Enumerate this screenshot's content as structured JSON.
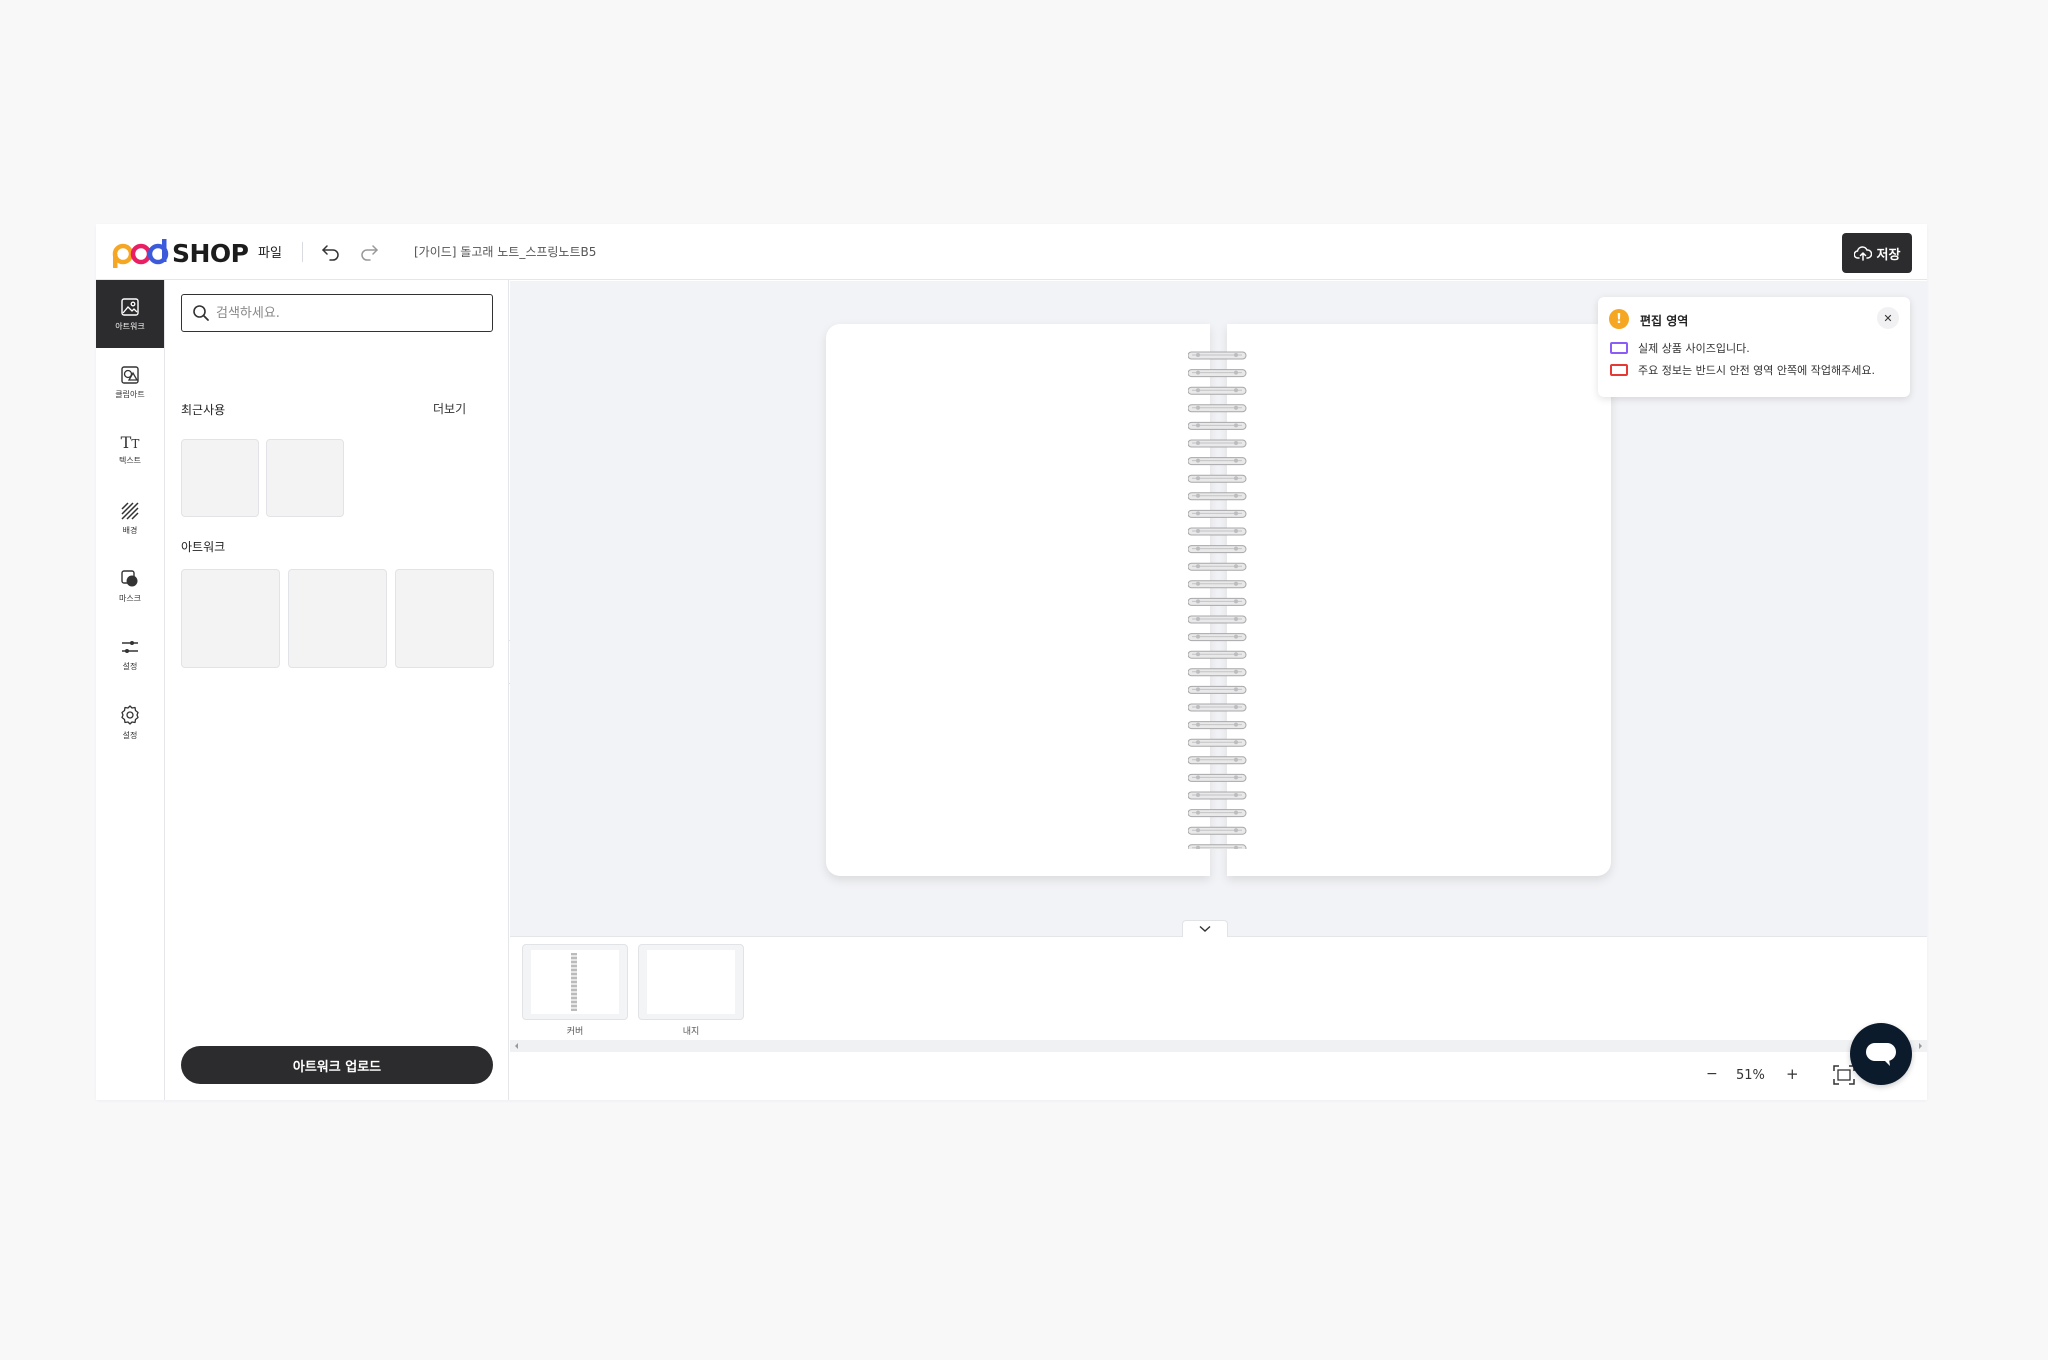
{
  "header": {
    "logo_text": "SHOP",
    "file_menu": "파일",
    "doc_title": "[가이드] 돌고래 노트_스프링노트B5",
    "save_label": "저장"
  },
  "rail": {
    "items": [
      {
        "label": "아트워크",
        "icon": "artwork-icon",
        "active": true
      },
      {
        "label": "클립아트",
        "icon": "clipart-icon"
      },
      {
        "label": "텍스트",
        "icon": "text-icon"
      },
      {
        "label": "배경",
        "icon": "background-icon"
      },
      {
        "label": "마스크",
        "icon": "mask-icon"
      },
      {
        "label": "설정",
        "icon": "sliders-icon"
      },
      {
        "label": "설정",
        "icon": "gear-icon"
      }
    ]
  },
  "panel": {
    "search_placeholder": "검색하세요.",
    "recent_title": "최근사용",
    "more_label": "더보기",
    "artwork_title": "아트워크",
    "upload_label": "아트워크 업로드"
  },
  "notice": {
    "title": "편집 영역",
    "rows": [
      {
        "text": "실제 상품 사이즈입니다.",
        "color": "#8b5cf6"
      },
      {
        "text": "주요 정보는 반드시 안전 영역 안쪽에 작업해주세요.",
        "color": "#e53935"
      }
    ]
  },
  "pages": {
    "items": [
      {
        "label": "커버"
      },
      {
        "label": "내지"
      }
    ]
  },
  "zoom": {
    "minus": "−",
    "value": "51%",
    "plus": "+"
  },
  "colors": {
    "dark": "#2c2c2e",
    "canvas_bg": "#f2f3f6",
    "chat": "#0c1b2c"
  }
}
